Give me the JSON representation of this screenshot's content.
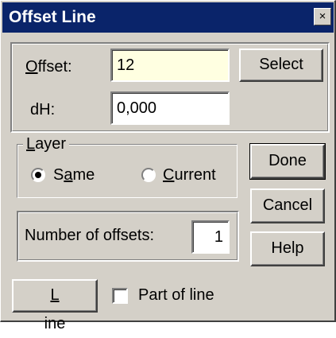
{
  "window": {
    "title": "Offset Line",
    "close_glyph": "×"
  },
  "offset": {
    "label_first": "O",
    "label_rest": "ffset:",
    "value": "12"
  },
  "dh": {
    "label": "dH:",
    "value": "0,000"
  },
  "buttons": {
    "select": "Select",
    "done": "Done",
    "cancel": "Cancel",
    "help": "Help",
    "line_first": "L",
    "line_rest": "ine"
  },
  "layer": {
    "legend_first": "L",
    "legend_rest": "ayer",
    "same_pre": "S",
    "same_u": "a",
    "same_post": "me",
    "current_first": "C",
    "current_rest": "urrent",
    "selected": "Same"
  },
  "offsets": {
    "label": "Number of offsets:",
    "value": "1"
  },
  "part_of_line": {
    "label": "Part of line",
    "checked": false
  },
  "colors": {
    "title_bar": "#0a246a",
    "dialog_face": "#d4d0c8",
    "offset_field_bg": "#ffffe1"
  }
}
